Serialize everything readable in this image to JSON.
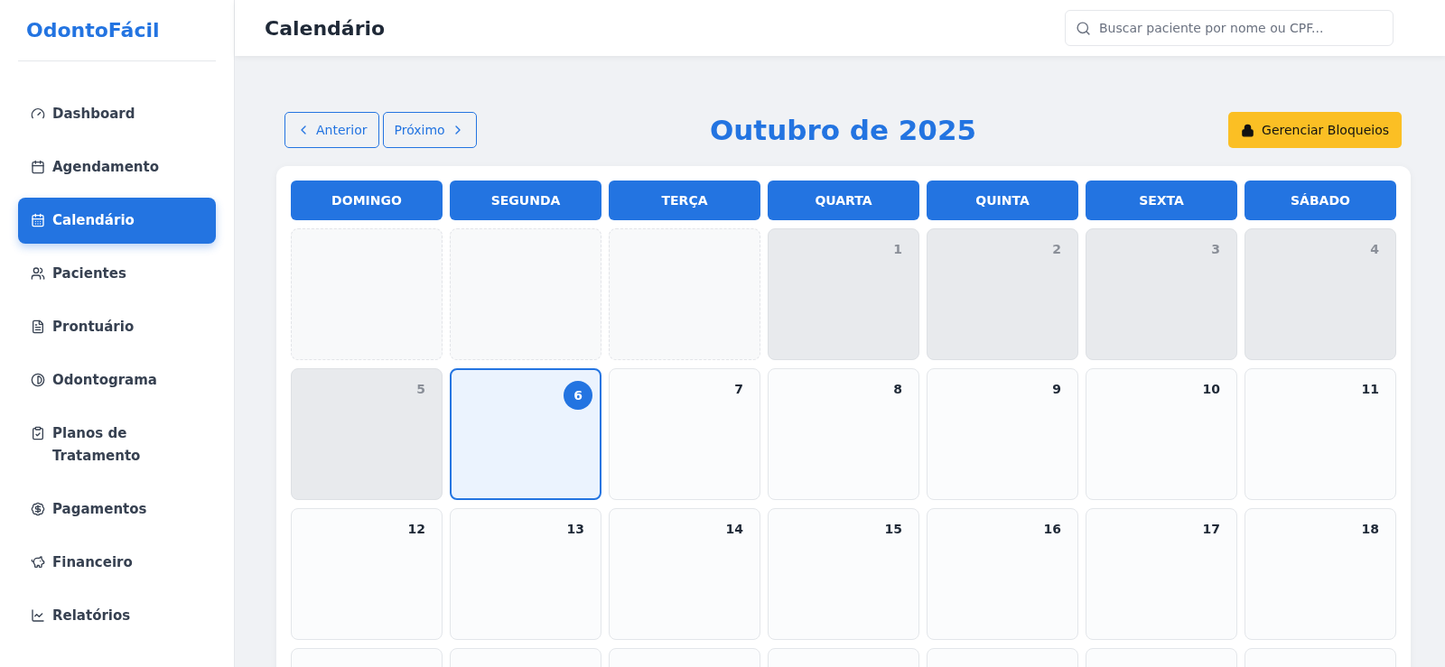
{
  "sidebar": {
    "logo": "OdontoFácil",
    "items": [
      {
        "label": "Dashboard",
        "selected": false
      },
      {
        "label": "Agendamento",
        "selected": false
      },
      {
        "label": "Calendário",
        "selected": true
      },
      {
        "label": "Pacientes",
        "selected": false
      },
      {
        "label": "Prontuário",
        "selected": false
      },
      {
        "label": "Odontograma",
        "selected": false
      },
      {
        "label": "Planos de Tratamento",
        "selected": false
      },
      {
        "label": "Pagamentos",
        "selected": false
      },
      {
        "label": "Financeiro",
        "selected": false
      },
      {
        "label": "Relatórios",
        "selected": false
      }
    ]
  },
  "header": {
    "title": "Calendário",
    "search": {
      "placeholder": "Buscar paciente por nome ou CPF..."
    }
  },
  "toolbar": {
    "prev": "Anterior",
    "next": "Próximo",
    "month": "Outubro de 2025",
    "manage": "Gerenciar Bloqueios"
  },
  "calendar": {
    "weekdays": [
      "DOMINGO",
      "SEGUNDA",
      "TERÇA",
      "QUARTA",
      "QUINTA",
      "SEXTA",
      "SÁBADO"
    ],
    "days": [
      {
        "kind": "empty"
      },
      {
        "kind": "empty"
      },
      {
        "kind": "empty"
      },
      {
        "kind": "past",
        "day": "1"
      },
      {
        "kind": "past",
        "day": "2"
      },
      {
        "kind": "past",
        "day": "3"
      },
      {
        "kind": "past",
        "day": "4"
      },
      {
        "kind": "past",
        "day": "5"
      },
      {
        "kind": "today",
        "day": "6"
      },
      {
        "kind": "future",
        "day": "7"
      },
      {
        "kind": "future",
        "day": "8"
      },
      {
        "kind": "future",
        "day": "9"
      },
      {
        "kind": "future",
        "day": "10"
      },
      {
        "kind": "future",
        "day": "11"
      },
      {
        "kind": "future",
        "day": "12"
      },
      {
        "kind": "future",
        "day": "13"
      },
      {
        "kind": "future",
        "day": "14"
      },
      {
        "kind": "future",
        "day": "15"
      },
      {
        "kind": "future",
        "day": "16"
      },
      {
        "kind": "future",
        "day": "17"
      },
      {
        "kind": "future",
        "day": "18"
      },
      {
        "kind": "future"
      },
      {
        "kind": "future"
      },
      {
        "kind": "future"
      },
      {
        "kind": "future"
      },
      {
        "kind": "future"
      },
      {
        "kind": "future"
      },
      {
        "kind": "future"
      }
    ]
  }
}
